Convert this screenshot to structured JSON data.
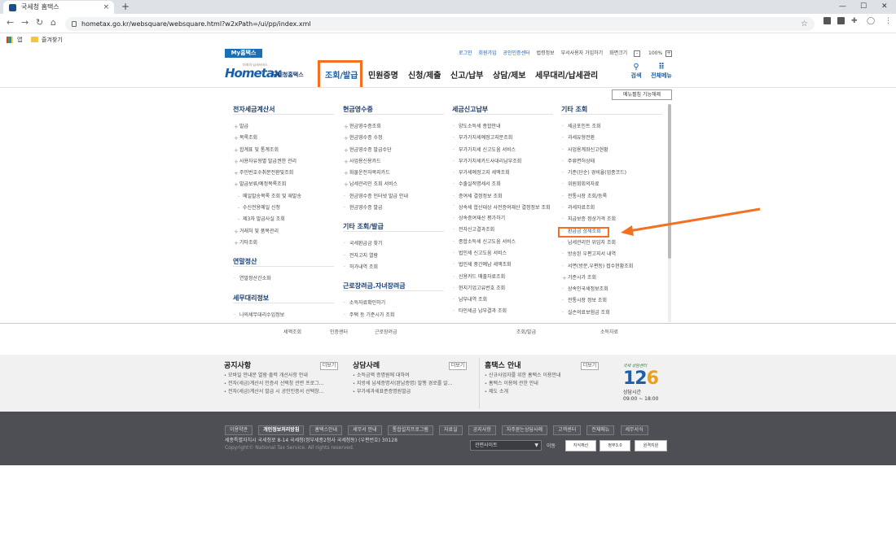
{
  "browser": {
    "tab_title": "국세청 홈택스",
    "tab_close": "×",
    "new_tab": "+",
    "url": "hometax.go.kr/websquare/websquare.html?w2xPath=/ui/pp/index.xml",
    "bookmarks": [
      "앱",
      "즐겨찾기"
    ]
  },
  "site": {
    "my_hometax": "My홈택스",
    "top_links": [
      "로그인",
      "회원가입",
      "공인인증센터",
      "법령정보",
      "부서사용자 가입하기",
      "화면크기"
    ],
    "zoom_minus": "-",
    "zoom_level": "100%",
    "zoom_plus": "+",
    "logo_text": "Hometax",
    "logo_sub": "국세청홈택스",
    "logo_tagline": "미래의 납세서비스",
    "nav": [
      "조회/발급",
      "민원증명",
      "신청/제출",
      "신고/납부",
      "상담/제보",
      "세무대리/납세관리"
    ],
    "search_label": "검색",
    "allmenu_label": "전체메뉴",
    "menu_close": "메뉴펼침 기능해제"
  },
  "menu": {
    "col1": {
      "sections": [
        {
          "title": "전자세금계산서",
          "items": [
            {
              "label": "발급",
              "t": "plus"
            },
            {
              "label": "목록조회",
              "t": "plus"
            },
            {
              "label": "합계표 및 통계조회",
              "t": "plus"
            },
            {
              "label": "사용자유형별 발급권한 관리",
              "t": "plus"
            },
            {
              "label": "주민번호수취분전환및조회",
              "t": "plus"
            },
            {
              "label": "발급보류/예정목록조회",
              "t": "plus"
            },
            {
              "label": "메일발송목록 조회 및 재발송",
              "t": "sub"
            },
            {
              "label": "수신전용메일 신청",
              "t": "sub"
            },
            {
              "label": "제3자 발급사실 조회",
              "t": "sub"
            },
            {
              "label": "거래처 및 품목관리",
              "t": "plus"
            },
            {
              "label": "기타조회",
              "t": "plus"
            }
          ]
        },
        {
          "title": "연말정산",
          "items": [
            {
              "label": "연말정산간소화",
              "t": "dot"
            }
          ]
        },
        {
          "title": "세무대리정보",
          "items": [
            {
              "label": "나의세무대리수임정보",
              "t": "dot"
            }
          ]
        }
      ]
    },
    "col2": {
      "sections": [
        {
          "title": "현금영수증",
          "items": [
            {
              "label": "현금영수증조회",
              "t": "plus"
            },
            {
              "label": "현금영수증 수정",
              "t": "plus"
            },
            {
              "label": "현금영수증 발급수단",
              "t": "plus"
            },
            {
              "label": "사업용신용카드",
              "t": "plus"
            },
            {
              "label": "화물운전자복지카드",
              "t": "plus"
            },
            {
              "label": "납세관리인 조회 서비스",
              "t": "plus"
            },
            {
              "label": "현금영수증 인터넷 발급 안내",
              "t": "dot"
            },
            {
              "label": "현금영수증 발급",
              "t": "dot"
            }
          ]
        },
        {
          "title": "기타 조회/발급",
          "items": [
            {
              "label": "국세환급금 찾기",
              "t": "dot"
            },
            {
              "label": "전자고지 열람",
              "t": "dot"
            },
            {
              "label": "허가내역 조회",
              "t": "dot"
            }
          ]
        },
        {
          "title": "근로장려금.자녀장려금",
          "items": [
            {
              "label": "소득자료확인하기",
              "t": "dot"
            },
            {
              "label": "주택 등 기준시가 조회",
              "t": "dot"
            }
          ]
        }
      ]
    },
    "col3": {
      "sections": [
        {
          "title": "세금신고납부",
          "items": [
            {
              "label": "양도소득세 종합안내",
              "t": "dot"
            },
            {
              "label": "부가가치세예정고지분조회",
              "t": "dot"
            },
            {
              "label": "부가가치세 신고도움 서비스",
              "t": "dot"
            },
            {
              "label": "부가가치세카드사대리납부조회",
              "t": "dot"
            },
            {
              "label": "부가세예정고지 세액조회",
              "t": "dot"
            },
            {
              "label": "수출실적명세서 조회",
              "t": "dot"
            },
            {
              "label": "증여세 결정정보 조회",
              "t": "dot"
            },
            {
              "label": "상속세 합산대상 사전증여재산 결정정보 조회",
              "t": "wrap"
            },
            {
              "label": "상속증여재산 평가하기",
              "t": "dot"
            },
            {
              "label": "전자신고결과조회",
              "t": "dot"
            },
            {
              "label": "종합소득세 신고도움 서비스",
              "t": "dot"
            },
            {
              "label": "법인세 신고도움 서비스",
              "t": "dot"
            },
            {
              "label": "법인세 중간예납 세액조회",
              "t": "dot"
            },
            {
              "label": "신용카드 매출자료조회",
              "t": "dot"
            },
            {
              "label": "현지기업고유번호 조회",
              "t": "dot"
            },
            {
              "label": "납부내역 조회",
              "t": "dot"
            },
            {
              "label": "타인세금 납부결과 조회",
              "t": "dot"
            }
          ]
        }
      ]
    },
    "col4": {
      "sections": [
        {
          "title": "기타 조회",
          "items": [
            {
              "label": "세금포인트 조회",
              "t": "dot"
            },
            {
              "label": "과세유형전환",
              "t": "dot"
            },
            {
              "label": "사업용계좌신고현황",
              "t": "dot"
            },
            {
              "label": "주류면허상태",
              "t": "dot"
            },
            {
              "label": "기준(단순) 경비율(업종코드)",
              "t": "dot"
            },
            {
              "label": "위원회회의자료",
              "t": "dot"
            },
            {
              "label": "전통시장 조회/등록",
              "t": "dot"
            },
            {
              "label": "과세자료조회",
              "t": "dot"
            },
            {
              "label": "지급보증 정상가격 조회",
              "t": "dot"
            },
            {
              "label": "환급금 상세조회",
              "t": "dot"
            },
            {
              "label": "납세관리인 위임자 조회",
              "t": "dot"
            },
            {
              "label": "방송된 우편고지서 내역",
              "t": "dot"
            },
            {
              "label": "서면(방문,우편등) 접수현황조회",
              "t": "dot"
            },
            {
              "label": "기준시가 조회",
              "t": "plus"
            },
            {
              "label": "상속인국세정보조회",
              "t": "dot"
            },
            {
              "label": "전통시장 정보 조회",
              "t": "dot"
            },
            {
              "label": "실손의료보험금 조회",
              "t": "dot"
            }
          ]
        }
      ]
    }
  },
  "peek": [
    "세액조회",
    "인증센터",
    "근로장려금",
    "조회/발급",
    "소득자료"
  ],
  "notice": {
    "more": "더보기",
    "boxes": [
      {
        "title": "공지사항",
        "items": [
          "모바일 안내문 열람·출력 개선사항 안내",
          "전자(세금)계산서 인증서 선택창 관련 프로그...",
          "전자(세금)계산서 발급 시 공인인증서 선택창..."
        ]
      },
      {
        "title": "상담사례",
        "items": [
          "소득금액 증명원에 대하여",
          "지방세 납세증명서(완납증명) 발행 경로를 알...",
          "부가세과세표준증명원발급"
        ]
      },
      {
        "title": "홈택스 안내",
        "items": [
          "신규사업자를 위한 홈택스 이용안내",
          "홈택스 이용에 관한 안내",
          "제도 소개"
        ]
      }
    ],
    "call_slogan": "국세 상담센터",
    "call_number_a": "12",
    "call_number_b": "6",
    "call_label": "상담시간",
    "call_hours": "09:00 ~ 18:00"
  },
  "footer": {
    "links": [
      "이용약관",
      "개인정보처리방침",
      "홈택스안내",
      "세무서 안내",
      "통합설치프로그램",
      "자료실",
      "공지사항",
      "자주묻는상담사례",
      "고객센터",
      "전체메뉴",
      "세무서식"
    ],
    "address": "세종특별자치시 국세청로 8-14 국세청(정부세종2청사 국세청동) (우편번호) 30128",
    "copyright": "Copyright© National Tax Service. All rights reserved.",
    "related_site": "관련사이트",
    "move": "이동",
    "badges": [
      "지식재산",
      "정부3.0",
      "원격지원"
    ]
  }
}
